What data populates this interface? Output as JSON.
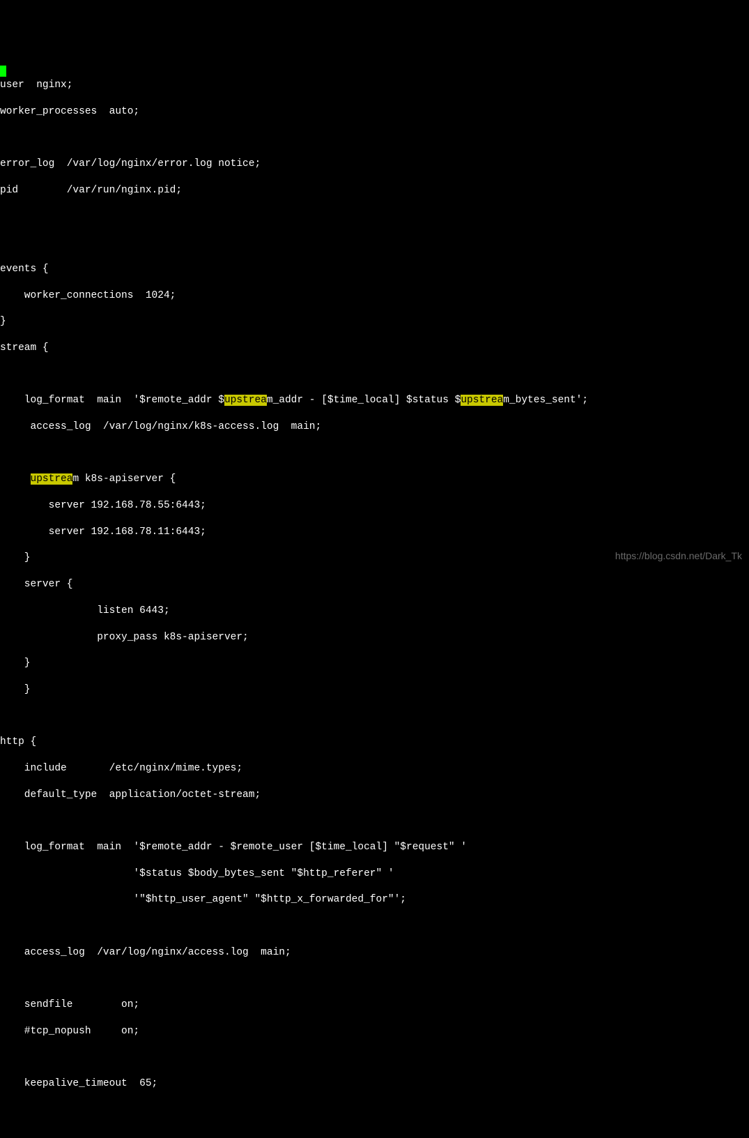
{
  "cursor": true,
  "watermark": "https://blog.csdn.net/Dark_Tk",
  "highlight_term": "upstrea",
  "lines": {
    "l1": "user  nginx;",
    "l2": "worker_processes  auto;",
    "l3": "",
    "l4": "error_log  /var/log/nginx/error.log notice;",
    "l5": "pid        /var/run/nginx.pid;",
    "l6": "",
    "l7": "",
    "l8": "events {",
    "l9": "    worker_connections  1024;",
    "l10": "}",
    "l11": "stream {",
    "l12": "",
    "l13_pre": "    log_format  main  '$remote_addr $",
    "l13_hl1": "upstrea",
    "l13_mid": "m_addr - [$time_local] $status $",
    "l13_hl2": "upstrea",
    "l13_post": "m_bytes_sent';",
    "l14": "     access_log  /var/log/nginx/k8s-access.log  main;",
    "l15": "",
    "l16_pre": "     ",
    "l16_hl": "upstrea",
    "l16_post": "m k8s-apiserver {",
    "l17": "        server 192.168.78.55:6443;",
    "l18": "        server 192.168.78.11:6443;",
    "l19": "    }",
    "l20": "    server {",
    "l21": "                listen 6443;",
    "l22": "                proxy_pass k8s-apiserver;",
    "l23": "    }",
    "l24": "    }",
    "l25": "",
    "l26": "http {",
    "l27": "    include       /etc/nginx/mime.types;",
    "l28": "    default_type  application/octet-stream;",
    "l29": "",
    "l30": "    log_format  main  '$remote_addr - $remote_user [$time_local] \"$request\" '",
    "l31": "                      '$status $body_bytes_sent \"$http_referer\" '",
    "l32": "                      '\"$http_user_agent\" \"$http_x_forwarded_for\"';",
    "l33": "",
    "l34": "    access_log  /var/log/nginx/access.log  main;",
    "l35": "",
    "l36": "    sendfile        on;",
    "l37": "    #tcp_nopush     on;",
    "l38": "",
    "l39": "    keepalive_timeout  65;"
  }
}
